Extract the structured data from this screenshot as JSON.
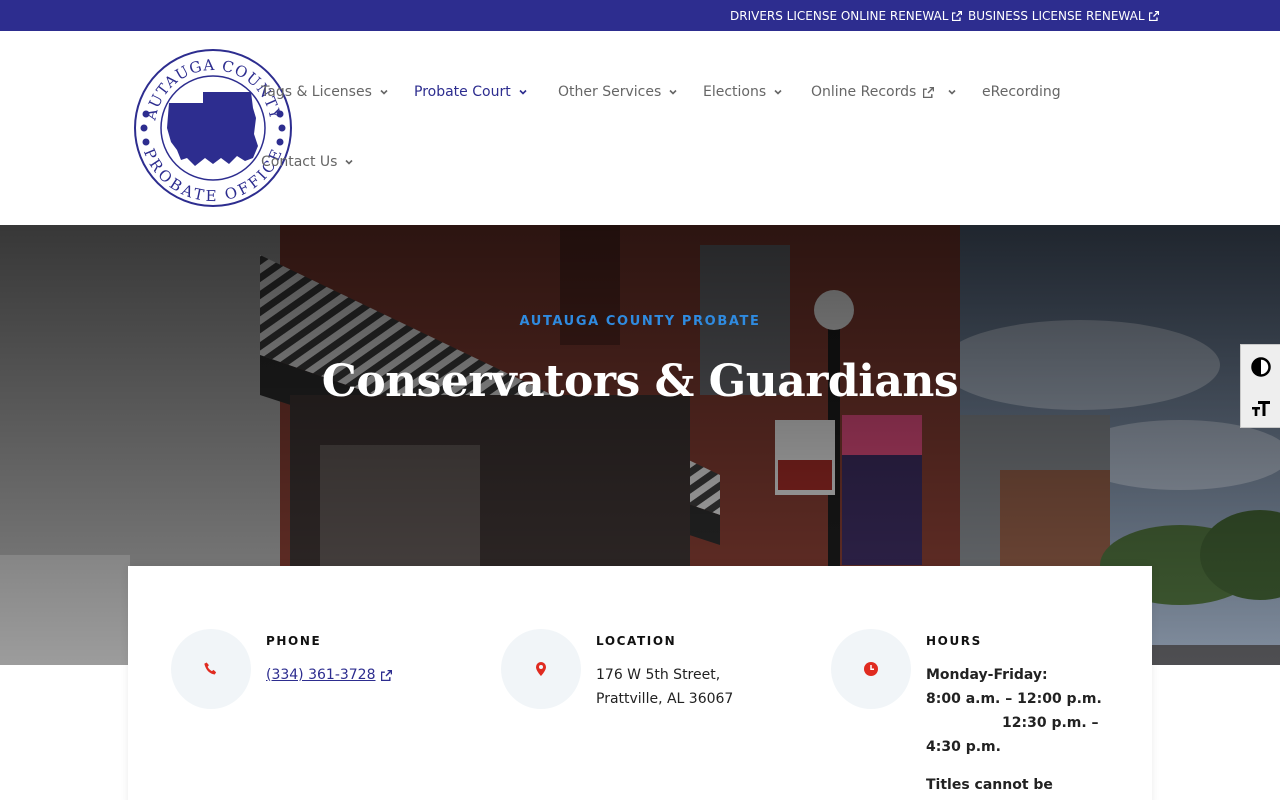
{
  "topbar": {
    "links": [
      {
        "label": "DRIVERS LICENSE ONLINE RENEWAL"
      },
      {
        "label": "BUSINESS LICENSE RENEWAL"
      }
    ]
  },
  "logo": {
    "alt": "Autauga County Probate Office",
    "ring_top": "AUTAUGA COUNTY",
    "ring_bottom": "PROBATE OFFICE"
  },
  "nav": {
    "items": [
      {
        "label": "Tags & Licenses"
      },
      {
        "label": "Probate Court"
      },
      {
        "label": "Other Services"
      },
      {
        "label": "Elections"
      },
      {
        "label": "Online Records"
      },
      {
        "label": "eRecording"
      },
      {
        "label": "Contact Us"
      }
    ],
    "active": "Probate Court"
  },
  "hero": {
    "kicker": "AUTAUGA COUNTY PROBATE",
    "title": "Conservators & Guardians"
  },
  "a11y": {
    "contrast_label": "Toggle High Contrast",
    "font_label": "Toggle Font Size"
  },
  "info": {
    "phone": {
      "heading": "PHONE",
      "number": "(334) 361-3728"
    },
    "location": {
      "heading": "LOCATION",
      "line1": "176 W 5th Street,",
      "line2": "Prattville, AL 36067"
    },
    "hours": {
      "heading": "HOURS",
      "days": "Monday-Friday:",
      "line1": "8:00 a.m. – 12:00 p.m.",
      "line2": "12:30 p.m. –",
      "line3": "4:30 p.m.",
      "note": "Titles cannot be"
    }
  },
  "colors": {
    "brand": "#2d2d8f",
    "accent": "#2f8be0",
    "icon_red": "#e02b20"
  }
}
